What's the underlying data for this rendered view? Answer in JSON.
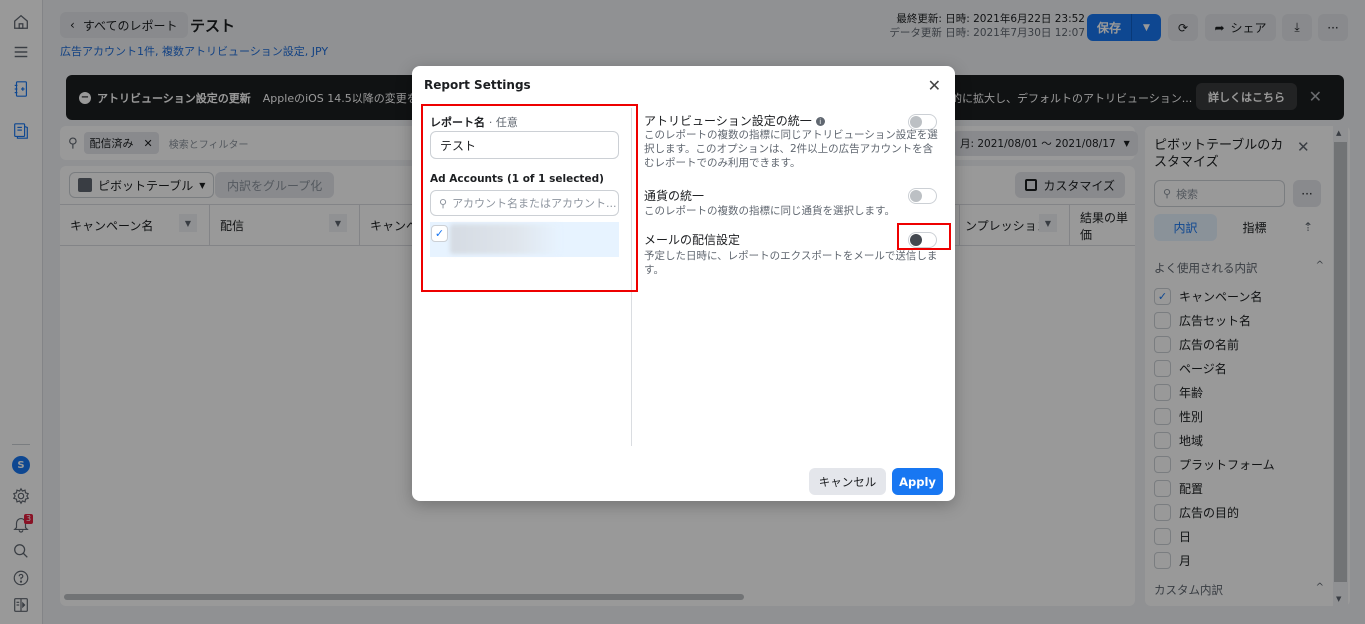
{
  "rail": {
    "icons": [
      "home-icon",
      "menu-icon",
      "reports-icon",
      "saved-reports-icon",
      "settings-icon",
      "notifications-icon",
      "search-icon",
      "help-icon",
      "panel-toggle-icon"
    ],
    "avatar_letter": "S",
    "notification_count": "3"
  },
  "header": {
    "back_label": "すべてのレポート",
    "title": "テスト",
    "subtitle": "広告アカウント1件, 複数アトリビューション設定, JPY",
    "last_updated": "最終更新: 日時: 2021年6月22日 23:52",
    "data_updated": "データ更新 日時: 2021年7月30日 12:07",
    "save_label": "保存",
    "share_label": "シェア"
  },
  "banner": {
    "title": "アトリビューション設定の更新",
    "text_left": "AppleのiOS 14.5以降の変更を受け",
    "text_right": "的に拡大し、デフォルトのアトリビューション...",
    "more_label": "詳しくはこちら"
  },
  "filterbar": {
    "chip_label": "配信済み",
    "placeholder": "検索とフィルター",
    "date_range": "月: 2021/08/01 ～ 2021/08/17"
  },
  "table": {
    "pivot_label": "ピボットテーブル",
    "group_label": "内訳をグループ化",
    "customize_label": "カスタマイズ",
    "columns": [
      "キャンペーン名",
      "配信",
      "キャンペ",
      "ンプレッション",
      "結果の単価"
    ]
  },
  "panel": {
    "title": "ピボットテーブルのカスタマイズ",
    "search_placeholder": "検索",
    "tabs": [
      "内訳",
      "指標"
    ],
    "section_common": "よく使用される内訳",
    "items": [
      {
        "label": "キャンペーン名",
        "checked": true
      },
      {
        "label": "広告セット名",
        "checked": false
      },
      {
        "label": "広告の名前",
        "checked": false
      },
      {
        "label": "ページ名",
        "checked": false
      },
      {
        "label": "年齢",
        "checked": false
      },
      {
        "label": "性別",
        "checked": false
      },
      {
        "label": "地域",
        "checked": false
      },
      {
        "label": "プラットフォーム",
        "checked": false
      },
      {
        "label": "配置",
        "checked": false
      },
      {
        "label": "広告の目的",
        "checked": false
      },
      {
        "label": "日",
        "checked": false
      },
      {
        "label": "月",
        "checked": false
      }
    ],
    "section_custom": "カスタム内訳"
  },
  "modal": {
    "title": "Report Settings",
    "report_name_label": "レポート名",
    "report_name_optional": "· 任意",
    "report_name_value": "テスト",
    "ad_accounts_label": "Ad Accounts (1 of 1 selected)",
    "account_search_placeholder": "アカウント名またはアカウント...",
    "account_checked": true,
    "options": [
      {
        "title": "アトリビューション設定の統一",
        "desc": "このレポートの複数の指標に同じアトリビューション設定を選択します。このオプションは、2件以上の広告アカウントを含むレポートでのみ利用できます。",
        "enabled": false,
        "has_info": true
      },
      {
        "title": "通貨の統一",
        "desc": "このレポートの複数の指標に同じ通貨を選択します。",
        "enabled": false,
        "has_info": false
      },
      {
        "title": "メールの配信設定",
        "desc": "予定した日時に、レポートのエクスポートをメールで送信します。",
        "enabled": false,
        "has_info": false
      }
    ],
    "cancel_label": "キャンセル",
    "apply_label": "Apply"
  },
  "colors": {
    "accent": "#1877f2",
    "highlight": "#ee0000",
    "banner_bg": "#1c1e21"
  }
}
